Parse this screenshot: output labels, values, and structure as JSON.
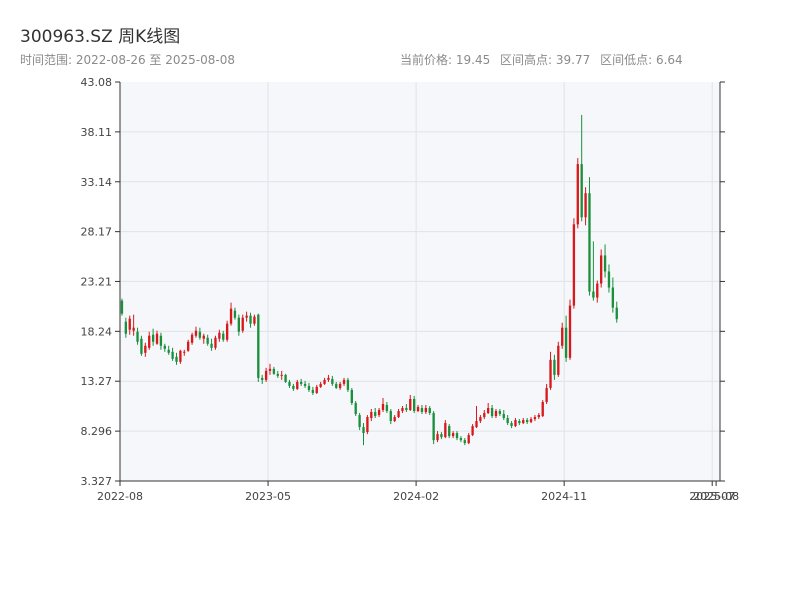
{
  "header": {
    "title": "300963.SZ 周K线图",
    "range_text": "时间范围: 2022-08-26 至 2025-08-08",
    "current_price_text": "当前价格: 19.45",
    "high_text": "区间高点: 39.77",
    "low_text": "区间低点: 6.64"
  },
  "colors": {
    "up": "#d7191c",
    "down": "#1a8f3c",
    "plot_bg": "#f5f7fa",
    "grid": "#dfe3e8",
    "axis": "#333333"
  },
  "chart_data": {
    "type": "candlestick",
    "ylim": [
      3.327,
      43.08
    ],
    "yticks": [
      3.327,
      8.296,
      13.27,
      18.24,
      23.21,
      28.17,
      33.14,
      38.11,
      43.08
    ],
    "ytick_labels": [
      "3.327",
      "8.296",
      "13.27",
      "18.24",
      "23.21",
      "28.17",
      "33.14",
      "38.11",
      "43.08"
    ],
    "xlim": [
      0,
      154
    ],
    "xticks": [
      {
        "x": 0,
        "label": "2022-08"
      },
      {
        "x": 38,
        "label": "2023-05"
      },
      {
        "x": 76,
        "label": "2024-02"
      },
      {
        "x": 114,
        "label": "2024-11"
      },
      {
        "x": 152,
        "label": "2025-07"
      },
      {
        "x": 153,
        "label": "2025-08"
      }
    ],
    "gridlines_y": [
      8.296,
      13.27,
      18.24,
      23.21,
      28.17,
      33.14,
      38.11
    ],
    "candles": [
      [
        0,
        21.3,
        21.5,
        19.8,
        20.0
      ],
      [
        1,
        19.2,
        19.6,
        17.6,
        18.0
      ],
      [
        2,
        18.4,
        19.8,
        17.9,
        19.5
      ],
      [
        3,
        18.3,
        19.9,
        17.8,
        18.6
      ],
      [
        4,
        18.2,
        18.6,
        16.9,
        17.2
      ],
      [
        5,
        17.5,
        17.8,
        15.8,
        16.0
      ],
      [
        6,
        16.1,
        17.1,
        15.7,
        16.8
      ],
      [
        7,
        16.6,
        18.2,
        16.4,
        17.8
      ],
      [
        8,
        17.9,
        18.5,
        16.8,
        17.2
      ],
      [
        9,
        17.0,
        18.3,
        16.9,
        18.0
      ],
      [
        10,
        17.8,
        18.1,
        16.4,
        16.8
      ],
      [
        11,
        16.8,
        17.0,
        16.2,
        16.5
      ],
      [
        12,
        16.4,
        16.8,
        15.9,
        16.1
      ],
      [
        13,
        16.2,
        16.6,
        15.3,
        15.5
      ],
      [
        14,
        15.7,
        16.1,
        14.9,
        15.2
      ],
      [
        15,
        15.2,
        16.4,
        15.0,
        16.3
      ],
      [
        16,
        16.1,
        16.4,
        15.8,
        16.2
      ],
      [
        17,
        16.3,
        17.4,
        16.2,
        17.2
      ],
      [
        18,
        17.1,
        18.1,
        16.9,
        17.9
      ],
      [
        19,
        17.8,
        18.7,
        17.6,
        18.3
      ],
      [
        20,
        18.2,
        18.6,
        17.4,
        17.6
      ],
      [
        21,
        17.5,
        18.0,
        17.0,
        17.8
      ],
      [
        22,
        17.6,
        17.9,
        16.8,
        17.0
      ],
      [
        23,
        17.0,
        17.5,
        16.3,
        16.6
      ],
      [
        24,
        16.6,
        17.8,
        16.4,
        17.6
      ],
      [
        25,
        17.5,
        18.4,
        17.2,
        18.1
      ],
      [
        26,
        18.0,
        18.3,
        17.2,
        17.4
      ],
      [
        27,
        17.4,
        19.3,
        17.2,
        19.0
      ],
      [
        28,
        19.0,
        21.1,
        18.8,
        20.5
      ],
      [
        29,
        20.3,
        20.6,
        19.4,
        19.6
      ],
      [
        30,
        19.6,
        19.9,
        17.8,
        18.2
      ],
      [
        31,
        18.3,
        19.9,
        18.1,
        19.6
      ],
      [
        32,
        19.6,
        20.2,
        19.2,
        19.8
      ],
      [
        33,
        19.8,
        20.1,
        18.6,
        19.0
      ],
      [
        34,
        19.0,
        19.9,
        18.8,
        19.7
      ],
      [
        35,
        19.9,
        20.0,
        13.2,
        13.6
      ],
      [
        36,
        13.6,
        13.9,
        13.0,
        13.4
      ],
      [
        37,
        13.4,
        14.6,
        13.2,
        14.3
      ],
      [
        38,
        14.3,
        15.0,
        13.9,
        14.5
      ],
      [
        39,
        14.5,
        14.7,
        13.9,
        14.0
      ],
      [
        40,
        14.0,
        14.3,
        13.6,
        13.8
      ],
      [
        41,
        13.8,
        14.3,
        13.4,
        13.9
      ],
      [
        42,
        13.9,
        14.0,
        13.1,
        13.2
      ],
      [
        43,
        13.2,
        13.4,
        12.6,
        12.8
      ],
      [
        44,
        12.8,
        13.0,
        12.3,
        12.5
      ],
      [
        45,
        12.5,
        13.4,
        12.4,
        13.2
      ],
      [
        46,
        13.2,
        13.5,
        12.8,
        13.0
      ],
      [
        47,
        13.0,
        13.3,
        12.6,
        12.8
      ],
      [
        48,
        12.8,
        13.1,
        12.2,
        12.4
      ],
      [
        49,
        12.4,
        12.7,
        11.9,
        12.1
      ],
      [
        50,
        12.1,
        12.9,
        12.0,
        12.7
      ],
      [
        51,
        12.7,
        13.2,
        12.6,
        13.0
      ],
      [
        52,
        13.0,
        13.6,
        12.9,
        13.4
      ],
      [
        53,
        13.4,
        13.9,
        13.2,
        13.6
      ],
      [
        54,
        13.5,
        13.8,
        12.8,
        13.0
      ],
      [
        55,
        13.0,
        13.2,
        12.5,
        12.6
      ],
      [
        56,
        12.6,
        13.2,
        12.4,
        13.0
      ],
      [
        57,
        13.0,
        13.6,
        12.8,
        13.4
      ],
      [
        58,
        13.4,
        13.6,
        12.2,
        12.4
      ],
      [
        59,
        12.4,
        12.6,
        10.9,
        11.1
      ],
      [
        60,
        11.1,
        11.3,
        9.8,
        10.0
      ],
      [
        61,
        9.9,
        10.1,
        8.4,
        8.7
      ],
      [
        62,
        8.7,
        9.1,
        6.9,
        8.1
      ],
      [
        63,
        8.2,
        9.9,
        8.0,
        9.7
      ],
      [
        64,
        9.6,
        10.5,
        9.3,
        10.2
      ],
      [
        65,
        10.2,
        10.6,
        9.6,
        9.8
      ],
      [
        66,
        9.9,
        10.6,
        9.7,
        10.4
      ],
      [
        67,
        10.4,
        11.6,
        10.2,
        11.0
      ],
      [
        68,
        10.9,
        11.2,
        10.1,
        10.3
      ],
      [
        69,
        10.3,
        10.5,
        9.0,
        9.3
      ],
      [
        70,
        9.3,
        9.9,
        9.2,
        9.7
      ],
      [
        71,
        9.7,
        10.5,
        9.6,
        10.3
      ],
      [
        72,
        10.3,
        10.8,
        10.1,
        10.6
      ],
      [
        73,
        10.6,
        11.0,
        10.2,
        10.4
      ],
      [
        74,
        10.4,
        11.9,
        10.3,
        11.5
      ],
      [
        75,
        11.5,
        11.8,
        10.1,
        10.3
      ],
      [
        76,
        10.3,
        10.9,
        10.2,
        10.7
      ],
      [
        77,
        10.6,
        10.9,
        10.0,
        10.2
      ],
      [
        78,
        10.2,
        10.9,
        10.0,
        10.6
      ],
      [
        79,
        10.6,
        10.8,
        9.9,
        10.1
      ],
      [
        80,
        10.1,
        10.3,
        7.0,
        7.4
      ],
      [
        81,
        7.4,
        8.3,
        7.2,
        8.0
      ],
      [
        82,
        8.0,
        8.2,
        7.5,
        7.7
      ],
      [
        83,
        7.7,
        9.4,
        7.6,
        9.1
      ],
      [
        84,
        8.8,
        9.0,
        7.6,
        7.8
      ],
      [
        85,
        7.8,
        8.3,
        7.6,
        8.1
      ],
      [
        86,
        8.1,
        8.3,
        7.4,
        7.6
      ],
      [
        87,
        7.6,
        7.8,
        7.2,
        7.4
      ],
      [
        88,
        7.4,
        7.6,
        6.9,
        7.1
      ],
      [
        89,
        7.1,
        8.1,
        7.0,
        7.9
      ],
      [
        90,
        7.9,
        9.0,
        7.8,
        8.8
      ],
      [
        91,
        8.7,
        10.8,
        8.6,
        9.3
      ],
      [
        92,
        9.3,
        9.9,
        9.1,
        9.7
      ],
      [
        93,
        9.7,
        10.4,
        9.5,
        10.1
      ],
      [
        94,
        10.1,
        11.1,
        10.0,
        10.6
      ],
      [
        95,
        10.6,
        10.9,
        9.6,
        9.8
      ],
      [
        96,
        9.8,
        10.5,
        9.6,
        10.3
      ],
      [
        97,
        10.3,
        10.5,
        9.8,
        10.0
      ],
      [
        98,
        10.0,
        10.4,
        9.4,
        9.6
      ],
      [
        99,
        9.6,
        9.9,
        8.9,
        9.1
      ],
      [
        100,
        9.1,
        9.3,
        8.6,
        8.8
      ],
      [
        101,
        8.8,
        9.6,
        8.7,
        9.4
      ],
      [
        102,
        9.3,
        9.5,
        8.9,
        9.1
      ],
      [
        103,
        9.1,
        9.6,
        9.0,
        9.4
      ],
      [
        104,
        9.4,
        9.6,
        9.0,
        9.2
      ],
      [
        105,
        9.2,
        9.7,
        9.1,
        9.5
      ],
      [
        106,
        9.5,
        9.9,
        9.3,
        9.7
      ],
      [
        107,
        9.7,
        10.1,
        9.5,
        9.9
      ],
      [
        108,
        9.8,
        11.4,
        9.7,
        11.2
      ],
      [
        109,
        11.2,
        13.0,
        11.0,
        12.6
      ],
      [
        110,
        12.6,
        16.2,
        12.4,
        15.4
      ],
      [
        111,
        15.4,
        15.9,
        13.4,
        13.9
      ],
      [
        112,
        13.9,
        17.2,
        13.7,
        16.8
      ],
      [
        113,
        16.8,
        19.1,
        16.5,
        18.6
      ],
      [
        114,
        18.6,
        19.8,
        15.2,
        15.6
      ],
      [
        115,
        15.6,
        21.4,
        15.4,
        20.8
      ],
      [
        116,
        20.8,
        29.5,
        20.5,
        28.9
      ],
      [
        117,
        28.9,
        35.5,
        28.5,
        34.9
      ],
      [
        118,
        34.9,
        39.8,
        29.2,
        29.6
      ],
      [
        119,
        29.6,
        32.6,
        28.8,
        32.0
      ],
      [
        120,
        32.0,
        33.6,
        21.8,
        22.2
      ],
      [
        121,
        22.2,
        27.2,
        21.3,
        21.6
      ],
      [
        122,
        21.6,
        23.3,
        21.1,
        23.0
      ],
      [
        123,
        23.0,
        26.4,
        22.6,
        25.8
      ],
      [
        124,
        25.8,
        26.9,
        23.6,
        24.2
      ],
      [
        125,
        24.2,
        24.9,
        22.1,
        22.6
      ],
      [
        126,
        22.6,
        23.6,
        20.1,
        20.6
      ],
      [
        127,
        20.6,
        21.2,
        19.1,
        19.45
      ]
    ]
  }
}
